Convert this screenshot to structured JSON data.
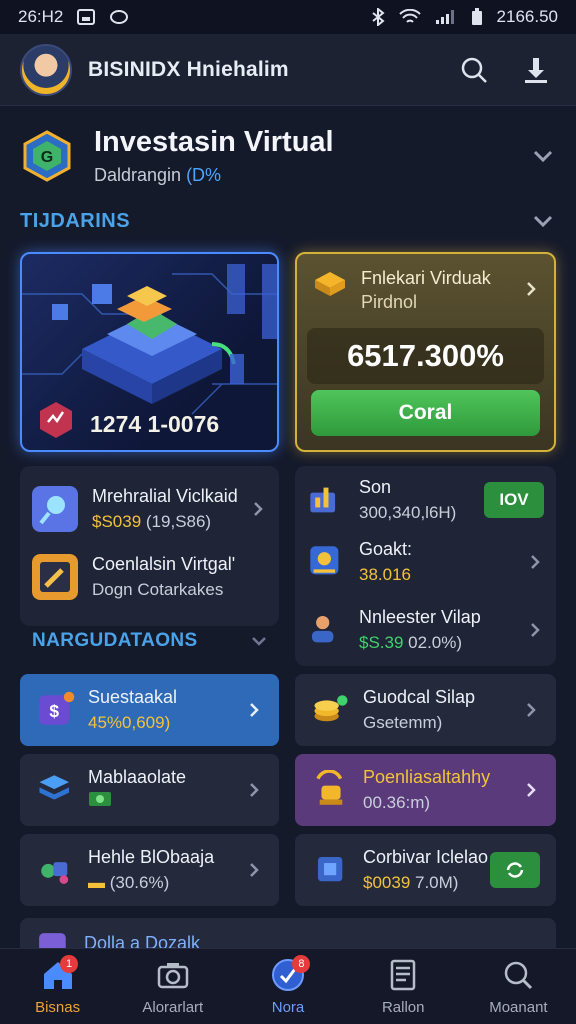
{
  "status_bar": {
    "time": "26:H2",
    "right_text": "2166.50"
  },
  "header": {
    "app_title": "BISINIDX Hniehalim"
  },
  "hero": {
    "title": "Investasin Virtual",
    "subtitle_prefix": "Daldrangin ",
    "subtitle_accent": "(D%"
  },
  "portfolio": {
    "section_title": "TIJDARINS",
    "feature_left": {
      "value": "1274 1-0076"
    },
    "feature_right": {
      "title": "Fnlekari Virduak",
      "subtitle": "Pirdnol",
      "value": "6517.300%",
      "button_label": "Coral"
    }
  },
  "left_list": [
    {
      "title": "Mrehralial Viclkaid",
      "sub_gold": "$S039",
      "sub_rest": " (19,S86)"
    },
    {
      "title": "Coenlalsin Virtgal'",
      "sub_rest": "Dogn Cotarkakes"
    }
  ],
  "right_list": [
    {
      "title": "Son",
      "sub_rest": "300,340,l6H)",
      "button_label": "IOV"
    },
    {
      "title": "Goakt:",
      "sub_gold": "38.016"
    },
    {
      "title": "Nnleester Vilap",
      "sub_green": "$S.39",
      "sub_rest": " 02.0%)"
    }
  ],
  "recommendations": {
    "section_title": "NARGUDATAONS"
  },
  "tiles": [
    {
      "title": "Suestaakal",
      "sub": "45%0,609)"
    },
    {
      "title": "Guodcal Silap",
      "sub": "Gsetemm)"
    },
    {
      "title": "Mablaaolate",
      "sub": ""
    },
    {
      "title": "Poenliasaltahhy",
      "sub": "00.36:m)"
    },
    {
      "title": "Hehle BlObaaja",
      "sub": "(30.6%)"
    },
    {
      "title": "Corbivar Iclelao",
      "sub_gold": "$0039",
      "sub_rest": " 7.0M)"
    },
    {
      "title": "Dolla a Dozalk"
    }
  ],
  "bottom_nav": [
    {
      "label": "Bisnas",
      "badge": "1"
    },
    {
      "label": "Alorarlart"
    },
    {
      "label": "Nora",
      "badge": "8"
    },
    {
      "label": "Rallon"
    },
    {
      "label": "Moanant"
    }
  ],
  "colors": {
    "accent_blue": "#4aa3e8",
    "gold": "#d4b13a",
    "green": "#3ed36b",
    "nav_active": "#f0a233"
  }
}
